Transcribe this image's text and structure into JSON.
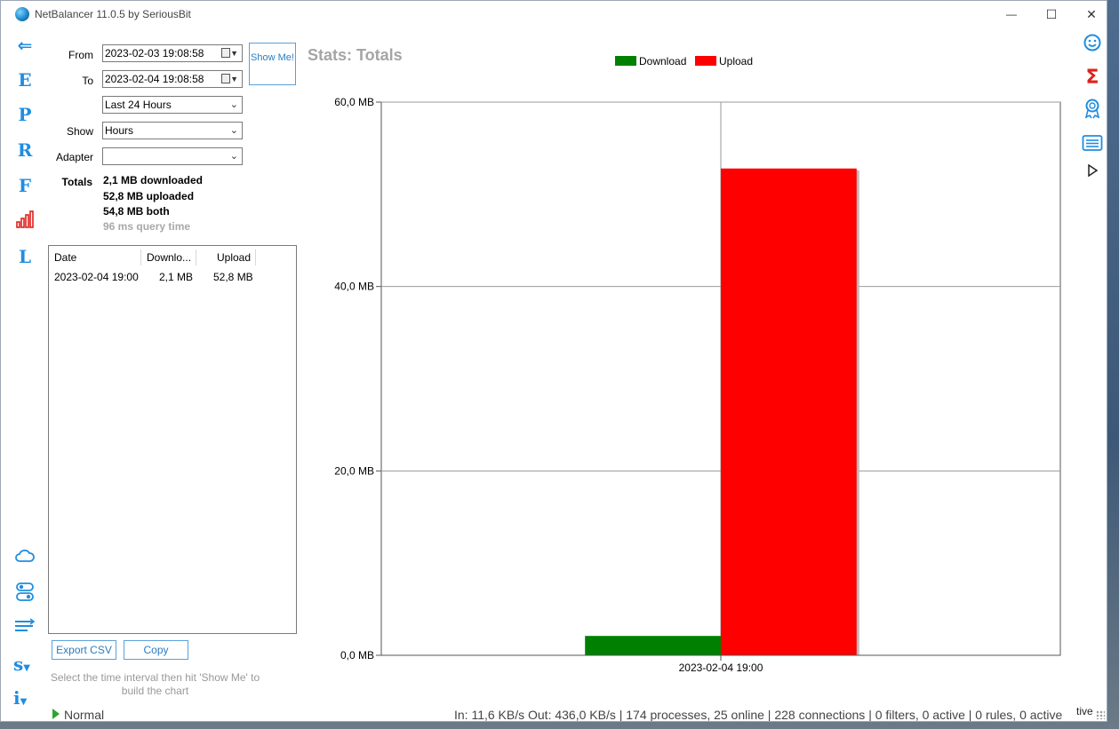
{
  "window": {
    "title": "NetBalancer 11.0.5 by SeriousBit",
    "minimize": "—",
    "maximize": "☐",
    "close": "✕"
  },
  "left_rail": {
    "back": "⇐",
    "e": "E",
    "p": "P",
    "r": "R",
    "f": "F",
    "l": "L",
    "s": "s",
    "i": "i"
  },
  "form": {
    "from_label": "From",
    "from_value": "2023-02-03 19:08:58",
    "to_label": "To",
    "to_value": "2023-02-04 19:08:58",
    "range_value": "Last 24 Hours",
    "show_label": "Show",
    "show_value": "Hours",
    "adapter_label": "Adapter",
    "adapter_value": "",
    "show_me_label": "Show Me!",
    "totals_label": "Totals",
    "totals_downloaded": "2,1 MB downloaded",
    "totals_uploaded": "52,8 MB uploaded",
    "totals_both": "54,8 MB both",
    "query_time": "96 ms query time"
  },
  "grid": {
    "headers": [
      "Date",
      "Downlo...",
      "Upload"
    ],
    "rows": [
      {
        "date": "2023-02-04 19:00",
        "download": "2,1 MB",
        "upload": "52,8 MB"
      }
    ]
  },
  "buttons": {
    "export_csv": "Export CSV",
    "copy": "Copy"
  },
  "hint": "Select the time interval then hit 'Show Me' to build the chart",
  "stats_title": "Stats: Totals",
  "status": {
    "mode": "Normal",
    "right": "In: 11,6 KB/s  Out: 436,0 KB/s  |  174 processes, 25 online  | 228 connections  | 0 filters, 0 active  |  0 rules, 0 active",
    "tail": "tive"
  },
  "colors": {
    "accent": "#1f8de0",
    "download": "#008000",
    "upload": "#ff0000"
  },
  "chart_data": {
    "type": "bar",
    "categories": [
      "2023-02-04 19:00"
    ],
    "series": [
      {
        "name": "Download",
        "values": [
          2.1
        ],
        "color": "#008000"
      },
      {
        "name": "Upload",
        "values": [
          52.8
        ],
        "color": "#ff0000"
      }
    ],
    "y_ticks": [
      "0,0 MB",
      "20,0 MB",
      "40,0 MB",
      "60,0 MB"
    ],
    "y_tick_values": [
      0,
      20,
      40,
      60
    ],
    "ylim": [
      0,
      60
    ],
    "grid": true,
    "legend": "top-center"
  }
}
